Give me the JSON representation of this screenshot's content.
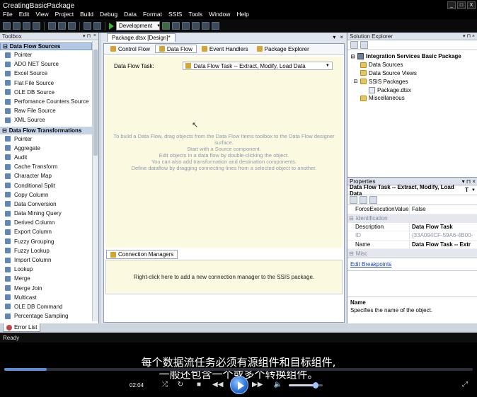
{
  "window": {
    "title": "CreatingBasicPackage",
    "min": "_",
    "max": "□",
    "close": "X"
  },
  "menu": [
    "File",
    "Edit",
    "View",
    "Project",
    "Build",
    "Debug",
    "Data",
    "Format",
    "SSIS",
    "Tools",
    "Window",
    "Help"
  ],
  "toolbar": {
    "configuration": "Development",
    "dropdown_arrow": "▼"
  },
  "toolbox": {
    "title": "Toolbox",
    "pin": "▾ ⊓",
    "close": "×",
    "categories": [
      {
        "name": "Data Flow Sources",
        "expander": "⊟",
        "items": [
          "Pointer",
          "ADO NET Source",
          "Excel Source",
          "Flat File Source",
          "OLE DB Source",
          "Perfomance Counters Source",
          "Raw File Source",
          "XML Source"
        ]
      },
      {
        "name": "Data Flow Transformations",
        "expander": "⊟",
        "items": [
          "Pointer",
          "Aggregate",
          "Audit",
          "Cache Transform",
          "Character Map",
          "Conditional Split",
          "Copy Column",
          "Data Conversion",
          "Data Mining Query",
          "Derived Column",
          "Export Column",
          "Fuzzy Grouping",
          "Fuzzy Lookup",
          "Import Column",
          "Lookup",
          "Merge",
          "Merge Join",
          "Multicast",
          "OLE DB Command",
          "Percentage Sampling"
        ]
      }
    ]
  },
  "document": {
    "tab": "Package.dtsx [Design]*",
    "tab_controls": [
      "▾",
      "×"
    ],
    "design_tabs": [
      {
        "label": "Control Flow",
        "active": false
      },
      {
        "label": "Data Flow",
        "active": true
      },
      {
        "label": "Event Handlers",
        "active": false
      },
      {
        "label": "Package Explorer",
        "active": false
      }
    ],
    "data_flow_task_label": "Data Flow Task:",
    "data_flow_task_value": "Data Flow Task -- Extract, Modify, Load Data",
    "hint_lines": [
      "To build a Data Flow, drag objects from the Data Flow Items toolbox to the Data Flow designer surface.",
      "Start with a Source component.",
      "Edit objects in a data flow by double-clicking the object.",
      "You can also add transformation and destination components.",
      "Define dataflow by dragging connecting lines from a selected object to another."
    ],
    "connection_managers_tab": "Connection Managers",
    "connection_managers_hint": "Right-click here to add a new connection manager to the SSIS package."
  },
  "solution_explorer": {
    "title": "Solution Explorer",
    "pin": "▾ ⊓ ×",
    "root": "Integration Services Basic Package",
    "nodes": [
      {
        "label": "Data Sources",
        "indent": 1,
        "icon": "folder"
      },
      {
        "label": "Data Source Views",
        "indent": 1,
        "icon": "folder"
      },
      {
        "label": "SSIS Packages",
        "indent": 1,
        "icon": "folder",
        "expander": "⊟"
      },
      {
        "label": "Package.dtsx",
        "indent": 2,
        "icon": "package"
      },
      {
        "label": "Miscellaneous",
        "indent": 1,
        "icon": "folder"
      }
    ],
    "root_expander": "⊟"
  },
  "properties": {
    "title": "Properties",
    "pin": "▾ ⊓ ×",
    "object": "Data Flow Task -- Extract, Modify, Load Data",
    "object_type": "T",
    "rows_top": [
      {
        "key": "ForceExecutionValue",
        "value": "False",
        "bold": false,
        "grey": false
      }
    ],
    "category_identification": "Identification",
    "rows_ident": [
      {
        "key": "Description",
        "value": "Data Flow Task",
        "bold": true,
        "grey": false
      },
      {
        "key": "ID",
        "value": "{33A094CF-59A6-4B00-",
        "bold": false,
        "grey": true
      },
      {
        "key": "Name",
        "value": "Data Flow Task -- Extr",
        "bold": true,
        "grey": false
      }
    ],
    "category_misc": "Misc",
    "cat_expander": "⊟",
    "link": "Edit Breakpoints",
    "desc_name": "Name",
    "desc_text": "Specifies the name of the object."
  },
  "bottom": {
    "error_tab": "Error List",
    "status": "Ready"
  },
  "video": {
    "subtitle_line1": "每个数据流任务必须有源组件和目标组件,",
    "subtitle_line2": "一般还包含一个或多个转换组件。",
    "time": "02:04",
    "seek_position": 0.09,
    "volume": 0.75,
    "icons": [
      "shuffle-icon",
      "repeat-icon",
      "stop-icon",
      "previous-icon",
      "play-icon",
      "next-icon",
      "volume-icon",
      "fullscreen-icon"
    ]
  }
}
